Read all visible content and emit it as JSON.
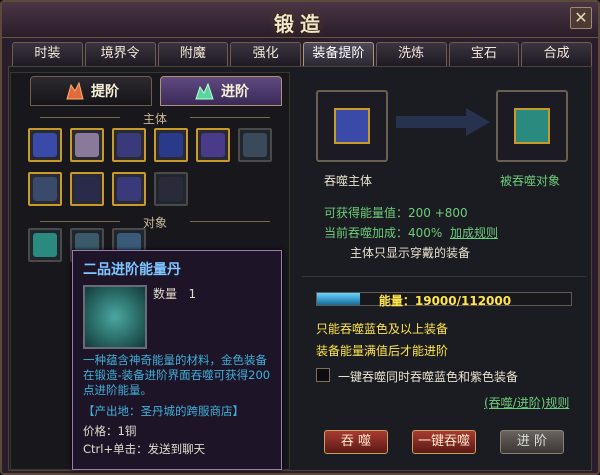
{
  "window": {
    "title": "锻造",
    "close_glyph": "✕"
  },
  "tabs": [
    "时装",
    "境界令",
    "附魔",
    "强化",
    "装备提阶",
    "洗炼",
    "宝石",
    "合成"
  ],
  "active_tab": "装备提阶",
  "subtabs": {
    "left": "提阶",
    "right": "进阶"
  },
  "sections": {
    "main": "主体",
    "target": "对象"
  },
  "tooltip": {
    "name": "二品进阶能量丹",
    "qty_label": "数量",
    "qty_value": "1",
    "description": "一种蕴含神奇能量的材料，金色装备在锻造-装备进阶界面吞噬可获得200点进阶能量。",
    "source": "【产出地：圣丹城的跨服商店】",
    "price": "价格：1铜",
    "ctrl": "Ctrl+单击：发送到聊天"
  },
  "right": {
    "devour_main": "吞噬主体",
    "devour_target": "被吞噬对象",
    "energy_gain_label": "可获得能量值：",
    "energy_gain_value": "200 +800",
    "bonus_label": "当前吞噬加成：",
    "bonus_value": "400%",
    "bonus_link": "加成规则",
    "only_worn": "主体只显示穿戴的装备",
    "energy_bar_text": "能量：19000/112000",
    "energy_current": 19000,
    "energy_max": 112000,
    "rule1": "只能吞噬蓝色及以上装备",
    "rule2": "装备能量满值后才能进阶",
    "check_label": "一键吞噬同时吞噬蓝色和紫色装备",
    "rules_link": "(吞噬/进阶)规则"
  },
  "buttons": {
    "devour": "吞 噬",
    "devour_all": "一键吞噬",
    "advance": "进 阶"
  },
  "colors": {
    "accent_gold": "#c89a2a",
    "green": "#6dcc7a",
    "yellow": "#ffe54a",
    "cyan": "#3fb0d8"
  }
}
